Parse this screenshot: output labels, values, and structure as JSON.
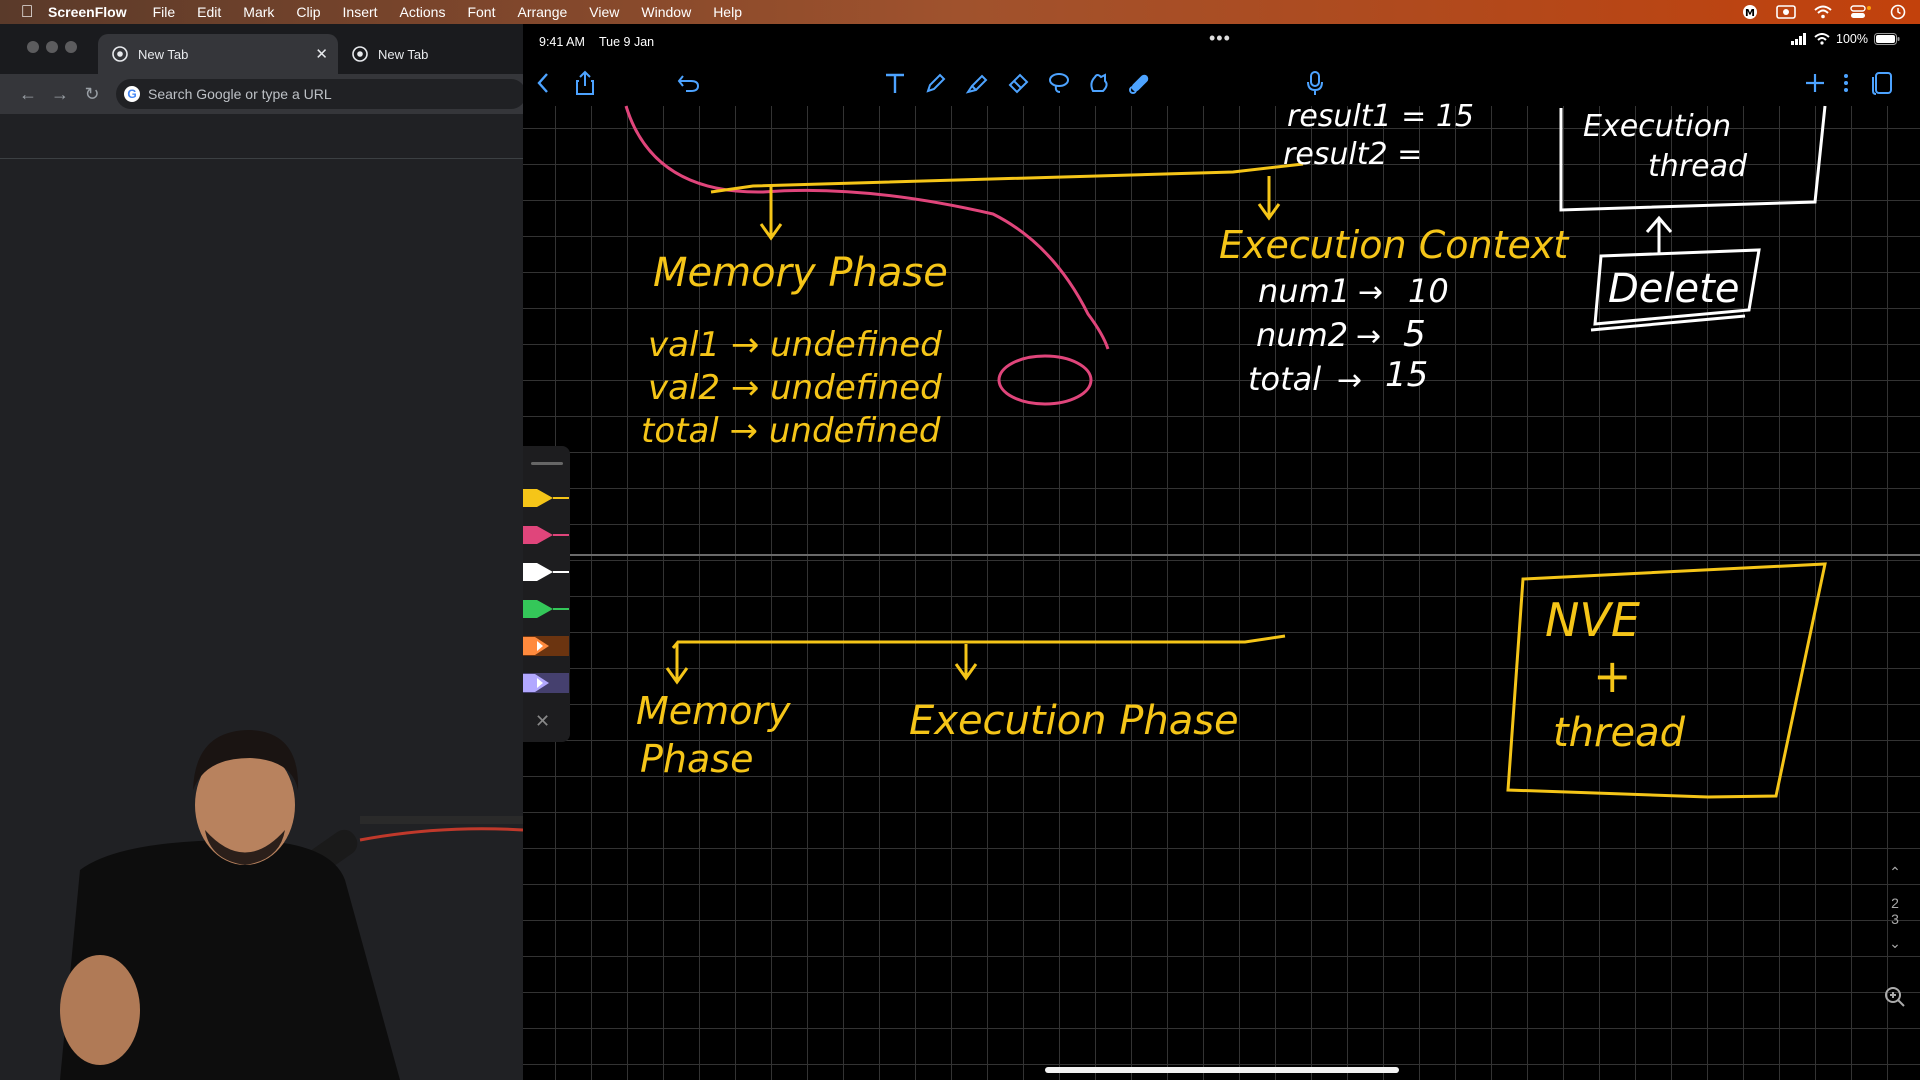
{
  "menubar": {
    "app_name": "ScreenFlow",
    "items": [
      "File",
      "Edit",
      "Mark",
      "Clip",
      "Insert",
      "Actions",
      "Font",
      "Arrange",
      "View",
      "Window",
      "Help"
    ]
  },
  "browser": {
    "tabs": [
      {
        "title": "New Tab",
        "active": true
      },
      {
        "title": "New Tab",
        "active": false
      }
    ],
    "omnibox_placeholder": "Search Google or type a URL"
  },
  "ipad_status": {
    "time": "9:41 AM",
    "date": "Tue 9 Jan",
    "battery": "100%"
  },
  "notes": {
    "top_section": {
      "memory_phase_title": "Memory Phase",
      "memory_lines": [
        "val1 → undefined",
        "val2 → undefined",
        "total → undefined"
      ],
      "context_title": "Execution Context",
      "context_lines": [
        {
          "name": "num1",
          "value": "10"
        },
        {
          "name": "num2",
          "value": "5"
        },
        {
          "name": "total",
          "value": "15"
        }
      ],
      "results": [
        "result1 = 15",
        "result2 ="
      ],
      "box_label": "Execution thread",
      "delete_label": "Delete"
    },
    "bottom_section": {
      "memory_phase": [
        "Memory",
        "Phase"
      ],
      "execution_phase": "Execution Phase",
      "box_lines": [
        "NVE",
        "+",
        "thread"
      ]
    }
  },
  "pager": {
    "current": "2",
    "total": "3"
  },
  "colors": {
    "ink_yellow": "#f5c518",
    "ink_pink": "#e0457b",
    "ink_white": "#ffffff",
    "ink_green": "#34c759"
  }
}
